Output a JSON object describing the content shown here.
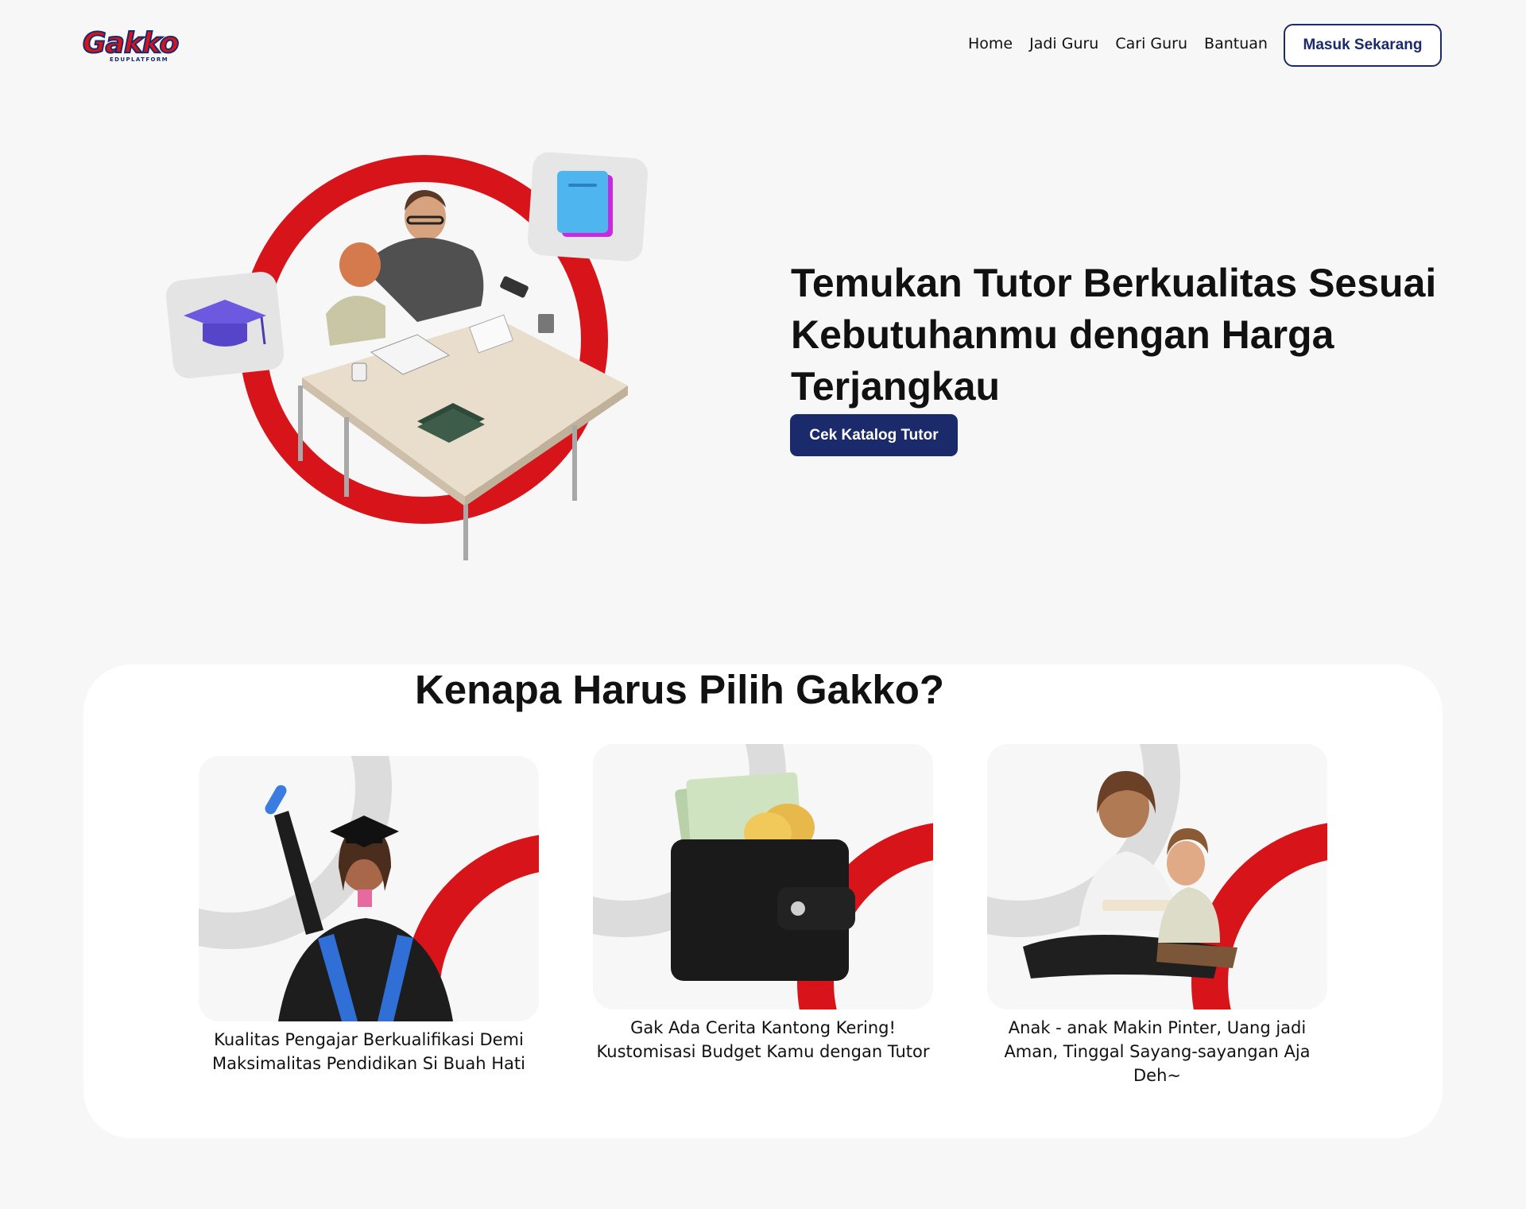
{
  "brand": {
    "name": "Gakko",
    "tagline": "EDUPLATFORM"
  },
  "nav": {
    "links": [
      "Home",
      "Jadi Guru",
      "Cari Guru",
      "Bantuan"
    ],
    "login_label": "Masuk Sekarang"
  },
  "hero": {
    "title": "Temukan Tutor Berkualitas Sesuai Kebutuhanmu dengan Harga Terjangkau",
    "cta_label": "Cek Katalog Tutor",
    "illustration": "tutor-and-child-at-desk"
  },
  "why": {
    "title": "Kenapa Harus Pilih Gakko?",
    "cards": [
      {
        "text": "Kualitas Pengajar Berkualifikasi Demi Maksimalitas Pendidikan Si Buah Hati",
        "image": "graduate-woman"
      },
      {
        "text": "Gak Ada Cerita Kantong Kering! Kustomisasi Budget Kamu dengan Tutor",
        "image": "wallet-with-money"
      },
      {
        "text": "Anak - anak Makin Pinter, Uang jadi Aman, Tinggal Sayang-sayangan Aja Deh~",
        "image": "mother-reading-with-child"
      }
    ]
  },
  "colors": {
    "brand_red": "#d8141b",
    "brand_navy": "#1b2a6b",
    "background": "#f7f7f7"
  }
}
